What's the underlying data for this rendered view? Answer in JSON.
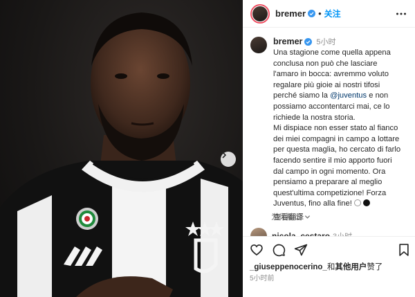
{
  "post": {
    "author": "bremer",
    "follow_label": "关注",
    "separator": "•",
    "time_ago": "5小时",
    "caption_lines": [
      "Una stagione come quella appena",
      "conclusa non può che lasciare",
      "l'amaro in bocca: avremmo voluto",
      "regalare più gioie ai nostri tifosi"
    ],
    "caption_pre_mention": "perché siamo la ",
    "mention": "@juventus",
    "caption_post_mention": " e non",
    "caption_lines_2": [
      "possiamo accontentarci mai, ce lo",
      "richiede la nostra storia.",
      "Mi dispiace non esser stato al fianco",
      "dei miei compagni in campo a lottare",
      "per questa maglia, ho cercato di farlo",
      "facendo sentire il mio apporto fuori",
      "dal campo in ogni momento. Ora",
      "pensiamo a preparare al meglio",
      "quest'ultima competizione! Forza"
    ],
    "caption_last": "Juventus, fino alla fine!",
    "see_translation": "查看翻译",
    "picks_label": "为你精选",
    "next_comment_user": "nicola_cestaro",
    "next_comment_time": "3小时",
    "likes_user": "_giuseppenocerino_",
    "likes_mid": "和",
    "likes_others": "其他用户",
    "likes_suffix": "赞了",
    "posted_time": "5小时前"
  },
  "icons": {
    "verified": "verified-badge-icon",
    "more": "more-options-icon",
    "like": "heart-icon",
    "comment": "comment-icon",
    "share": "paper-plane-icon",
    "save": "bookmark-icon",
    "next": "chevron-right-icon"
  },
  "colors": {
    "follow": "#0095f6",
    "verified": "#3897f0",
    "mention": "#00376b",
    "meta": "#8e8e8e"
  }
}
